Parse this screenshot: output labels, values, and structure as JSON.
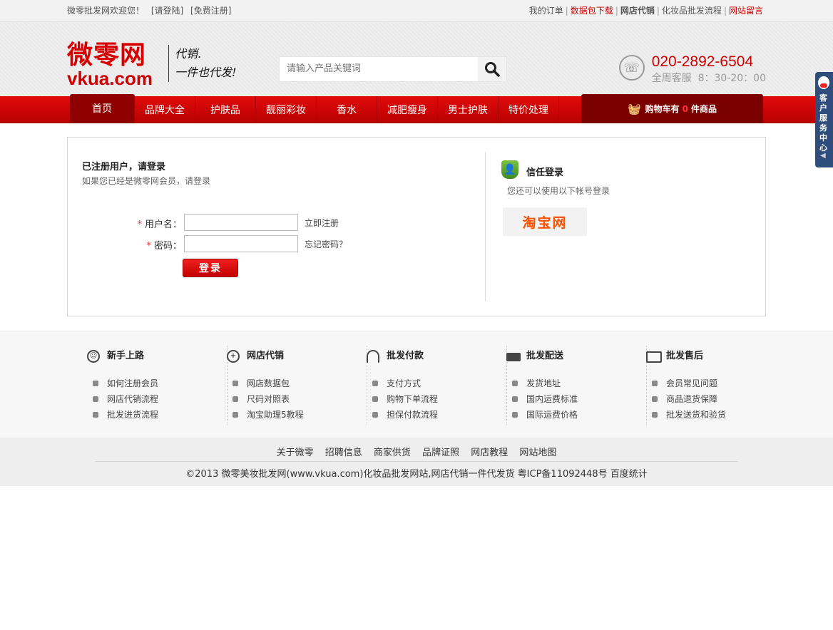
{
  "topbar": {
    "welcome": "微零批发网欢迎您！",
    "login_link": "[请登陆]",
    "register_link": "[免费注册]",
    "links": [
      "我的订单",
      "数据包下载",
      "网店代销",
      "化妆品批发流程",
      "网站留言"
    ]
  },
  "header": {
    "logo_cn": "微零网",
    "logo_en": "vkua.com",
    "slogan_line1": "代销.",
    "slogan_line2": "一件也代发!",
    "search_placeholder": "请输入产品关键词",
    "phone": "020-2892-6504",
    "hours_label": "全周客服",
    "hours_value": "8：30-20：00"
  },
  "nav": {
    "items": [
      "首页",
      "品牌大全",
      "护肤品",
      "靓丽彩妆",
      "香水",
      "减肥瘦身",
      "男士护肤",
      "特价处理"
    ],
    "cart_prefix": "购物车有",
    "cart_count": "0",
    "cart_suffix": "件商品"
  },
  "login": {
    "title": "已注册用户，请登录",
    "subtitle": "如果您已经是微零网会员，请登录",
    "username_label": "用户名：",
    "password_label": "密码：",
    "register_now": "立即注册",
    "forgot_password": "忘记密码？",
    "login_button": "登录"
  },
  "trust": {
    "title": "信任登录",
    "subtitle": "您还可以使用以下帐号登录",
    "taobao": "淘宝网"
  },
  "help": [
    {
      "title": "新手上路",
      "icon": "smiley-icon",
      "items": [
        "如何注册会员",
        "网店代销流程",
        "批发进货流程"
      ]
    },
    {
      "title": "网店代销",
      "icon": "compass-icon",
      "items": [
        "网店数据包",
        "尺码对照表",
        "淘宝助理5教程"
      ]
    },
    {
      "title": "批发付款",
      "icon": "headset-icon",
      "items": [
        "支付方式",
        "购物下单流程",
        "担保付款流程"
      ]
    },
    {
      "title": "批发配送",
      "icon": "truck-icon",
      "items": [
        "发货地址",
        "国内运费标准",
        "国际运费价格"
      ]
    },
    {
      "title": "批发售后",
      "icon": "card-icon",
      "items": [
        "会员常见问题",
        "商品退货保障",
        "批发送货和验货"
      ]
    }
  ],
  "footer": {
    "links": [
      "关于微零",
      "招聘信息",
      "商家供货",
      "品牌证照",
      "网店教程",
      "网站地图"
    ],
    "copyright": "©2013 微零美妆批发网(www.vkua.com)化妆品批发网站,网店代销一件代发货  粤ICP备11092448号  百度统计"
  },
  "service_tab": {
    "label": "客户服务中心"
  },
  "colors": {
    "brand_red": "#cc0000",
    "nav_dark": "#8f0000",
    "cart_bg": "#7a0000",
    "service_blue": "#2f4d7c"
  }
}
